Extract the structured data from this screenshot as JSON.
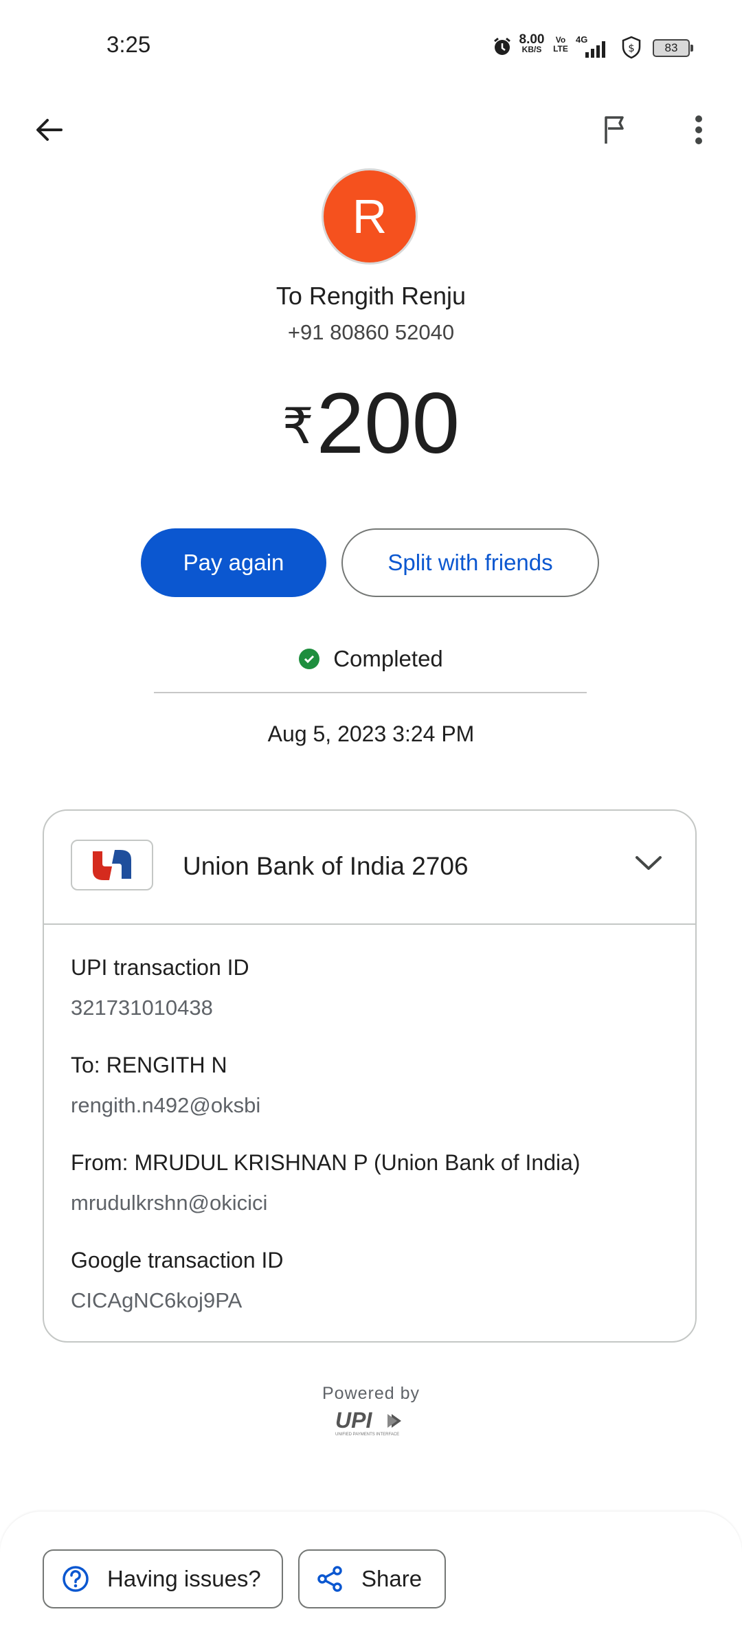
{
  "status_bar": {
    "time": "3:25",
    "net_speed_value": "8.00",
    "net_speed_unit": "KB/S",
    "volte": "Vo LTE",
    "network": "4G",
    "battery": "83"
  },
  "transaction": {
    "avatar_letter": "R",
    "avatar_color": "#f5511e",
    "recipient": "To Rengith Renju",
    "phone": "+91 80860 52040",
    "currency": "₹",
    "amount": "200",
    "pay_again_label": "Pay again",
    "split_label": "Split with friends",
    "status": "Completed",
    "datetime": "Aug 5, 2023 3:24 PM"
  },
  "card": {
    "bank_name": "Union Bank of India 2706",
    "details": [
      {
        "label": "UPI transaction ID",
        "value": "321731010438"
      },
      {
        "label": "To: RENGITH N",
        "value": "rengith.n492@oksbi"
      },
      {
        "label": "From: MRUDUL KRISHNAN P (Union Bank of India)",
        "value": "mrudulkrshn@okicici"
      },
      {
        "label": "Google transaction ID",
        "value": "CICAgNC6koj9PA"
      }
    ]
  },
  "footer": {
    "powered_by": "Powered by",
    "upi_logo_text": "UPI",
    "upi_tagline": "UNIFIED PAYMENTS INTERFACE"
  },
  "bottom_actions": {
    "issues_label": "Having issues?",
    "share_label": "Share"
  },
  "colors": {
    "primary": "#0b57d0",
    "success": "#1e8e3e",
    "avatar": "#f5511e"
  },
  "icons": [
    "back-arrow-icon",
    "flag-icon",
    "more-vert-icon",
    "check-circle-icon",
    "chevron-down-icon",
    "help-icon",
    "share-icon"
  ]
}
